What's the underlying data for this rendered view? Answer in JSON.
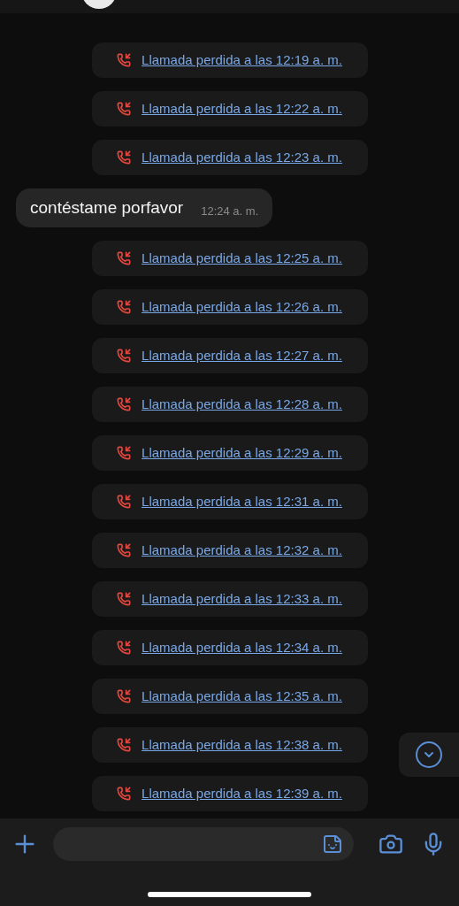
{
  "messages": [
    {
      "kind": "call",
      "text": "Llamada perdida a las 12:19 a. m."
    },
    {
      "kind": "call",
      "text": "Llamada perdida a las 12:22 a. m."
    },
    {
      "kind": "call",
      "text": "Llamada perdida a las 12:23 a. m."
    },
    {
      "kind": "text",
      "text": "contéstame porfavor",
      "time": "12:24 a. m."
    },
    {
      "kind": "call",
      "text": "Llamada perdida a las 12:25 a. m."
    },
    {
      "kind": "call",
      "text": "Llamada perdida a las 12:26 a. m."
    },
    {
      "kind": "call",
      "text": "Llamada perdida a las 12:27 a. m."
    },
    {
      "kind": "call",
      "text": "Llamada perdida a las 12:28 a. m."
    },
    {
      "kind": "call",
      "text": "Llamada perdida a las 12:29 a. m."
    },
    {
      "kind": "call",
      "text": "Llamada perdida a las 12:31 a. m."
    },
    {
      "kind": "call",
      "text": "Llamada perdida a las 12:32 a. m."
    },
    {
      "kind": "call",
      "text": "Llamada perdida a las 12:33 a. m."
    },
    {
      "kind": "call",
      "text": "Llamada perdida a las 12:34 a. m."
    },
    {
      "kind": "call",
      "text": "Llamada perdida a las 12:35 a. m."
    },
    {
      "kind": "call",
      "text": "Llamada perdida a las 12:38 a. m."
    },
    {
      "kind": "call",
      "text": "Llamada perdida a las 12:39 a. m."
    }
  ]
}
